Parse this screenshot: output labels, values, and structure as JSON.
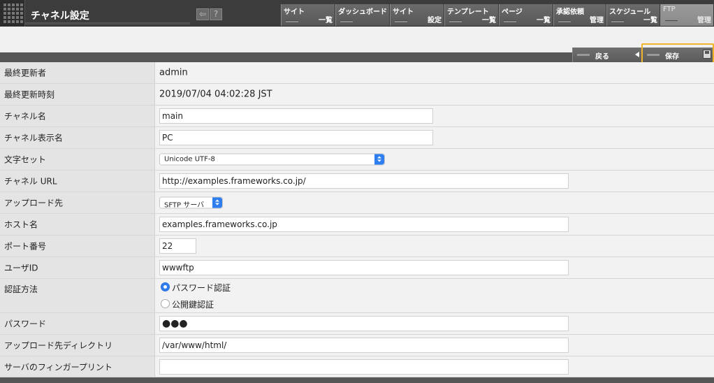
{
  "header": {
    "title": "チャネル設定",
    "icon_left": "⇦",
    "icon_help": "?"
  },
  "nav": [
    {
      "top": "サイト",
      "bottom": "一覧"
    },
    {
      "top": "ダッシュボード",
      "bottom": ""
    },
    {
      "top": "サイト",
      "bottom": "設定"
    },
    {
      "top": "テンプレート",
      "bottom": "一覧"
    },
    {
      "top": "ページ",
      "bottom": "一覧"
    },
    {
      "top": "承認依頼",
      "bottom": "管理"
    },
    {
      "top": "スケジュール",
      "bottom": "一覧"
    },
    {
      "top": "FTP",
      "bottom": "管理"
    }
  ],
  "toolbar": {
    "back_label": "戻る",
    "save_label": "保存"
  },
  "form": {
    "last_updated_by": {
      "label": "最終更新者",
      "value": "admin"
    },
    "last_updated_at": {
      "label": "最終更新時刻",
      "value": "2019/07/04 04:02:28 JST"
    },
    "channel_name": {
      "label": "チャネル名",
      "value": "main"
    },
    "channel_display_name": {
      "label": "チャネル表示名",
      "value": "PC"
    },
    "charset": {
      "label": "文字セット",
      "value": "Unicode UTF-8"
    },
    "channel_url": {
      "label": "チャネル URL",
      "value": "http://examples.frameworks.co.jp/"
    },
    "upload_target": {
      "label": "アップロード先",
      "value": "SFTP サーバ"
    },
    "host": {
      "label": "ホスト名",
      "value": "examples.frameworks.co.jp"
    },
    "port": {
      "label": "ポート番号",
      "value": "22"
    },
    "user_id": {
      "label": "ユーザID",
      "value": "wwwftp"
    },
    "auth": {
      "label": "認証方法",
      "options": [
        "パスワード認証",
        "公開鍵認証"
      ],
      "selected": "パスワード認証"
    },
    "password": {
      "label": "パスワード",
      "value": "●●●"
    },
    "upload_dir": {
      "label": "アップロード先ディレクトリ",
      "value": "/var/www/html/"
    },
    "fingerprint": {
      "label": "サーバのフィンガープリント",
      "value": ""
    }
  },
  "colors": {
    "accent": "#2f7ef0",
    "highlight": "#f0b42a",
    "header_bg": "#3c3c3c"
  }
}
